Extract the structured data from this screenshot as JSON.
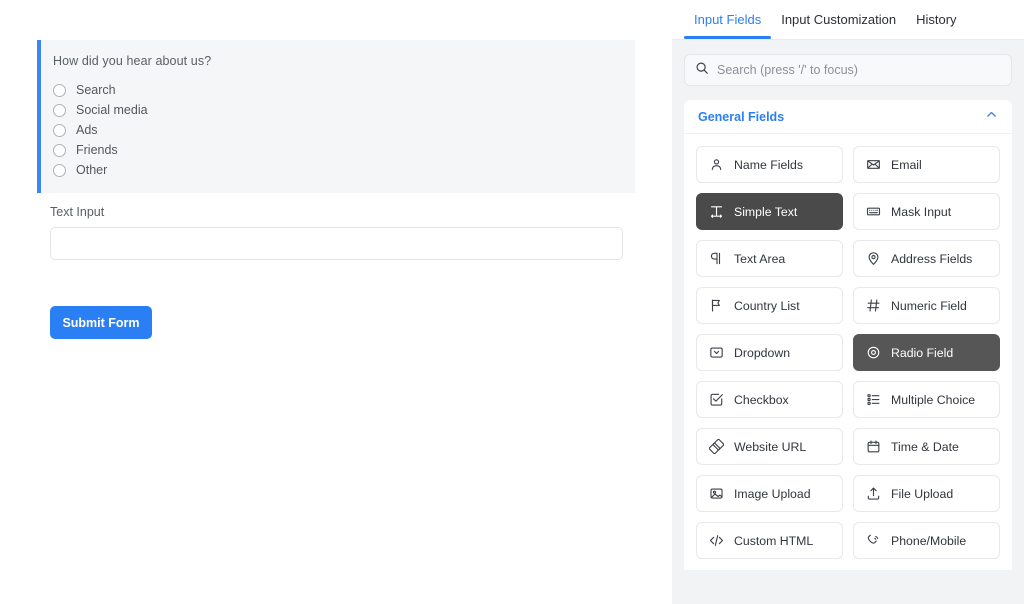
{
  "form": {
    "radio_group": {
      "legend": "How did you hear about us?",
      "options": [
        "Search",
        "Social media",
        "Ads",
        "Friends",
        "Other"
      ],
      "accent_color": "#3b87ef",
      "background": "#f5f6f7"
    },
    "text_field": {
      "label": "Text Input",
      "value": "",
      "placeholder": ""
    },
    "submit": {
      "label": "Submit Form",
      "color": "#2b7ff5"
    }
  },
  "library": {
    "tabs": [
      {
        "label": "Input Fields",
        "active": true
      },
      {
        "label": "Input Customization",
        "active": false
      },
      {
        "label": "History",
        "active": false
      }
    ],
    "search": {
      "placeholder": "Search (press '/' to focus)",
      "value": "",
      "icon": "search-icon"
    },
    "section": {
      "title": "General Fields",
      "collapse_icon": "chevron-up-icon",
      "title_color": "#2b7ff5"
    },
    "fields": [
      {
        "label": "Name Fields",
        "icon": "person-icon",
        "state": "default"
      },
      {
        "label": "Email",
        "icon": "envelope-icon",
        "state": "default"
      },
      {
        "label": "Simple Text",
        "icon": "text-width-icon",
        "state": "selected-dark"
      },
      {
        "label": "Mask Input",
        "icon": "keyboard-icon",
        "state": "default"
      },
      {
        "label": "Text Area",
        "icon": "paragraph-icon",
        "state": "default"
      },
      {
        "label": "Address Fields",
        "icon": "map-pin-icon",
        "state": "default"
      },
      {
        "label": "Country List",
        "icon": "flag-icon",
        "state": "default"
      },
      {
        "label": "Numeric Field",
        "icon": "hash-icon",
        "state": "default"
      },
      {
        "label": "Dropdown",
        "icon": "select-box-icon",
        "state": "default"
      },
      {
        "label": "Radio Field",
        "icon": "radio-circle-icon",
        "state": "selected-gray"
      },
      {
        "label": "Checkbox",
        "icon": "check-square-icon",
        "state": "default"
      },
      {
        "label": "Multiple Choice",
        "icon": "list-icon",
        "state": "default"
      },
      {
        "label": "Website URL",
        "icon": "link-icon",
        "state": "default"
      },
      {
        "label": "Time & Date",
        "icon": "calendar-icon",
        "state": "default"
      },
      {
        "label": "Image Upload",
        "icon": "image-icon",
        "state": "default"
      },
      {
        "label": "File Upload",
        "icon": "upload-icon",
        "state": "default"
      },
      {
        "label": "Custom HTML",
        "icon": "code-icon",
        "state": "default"
      },
      {
        "label": "Phone/Mobile",
        "icon": "phone-icon",
        "state": "default"
      }
    ]
  }
}
